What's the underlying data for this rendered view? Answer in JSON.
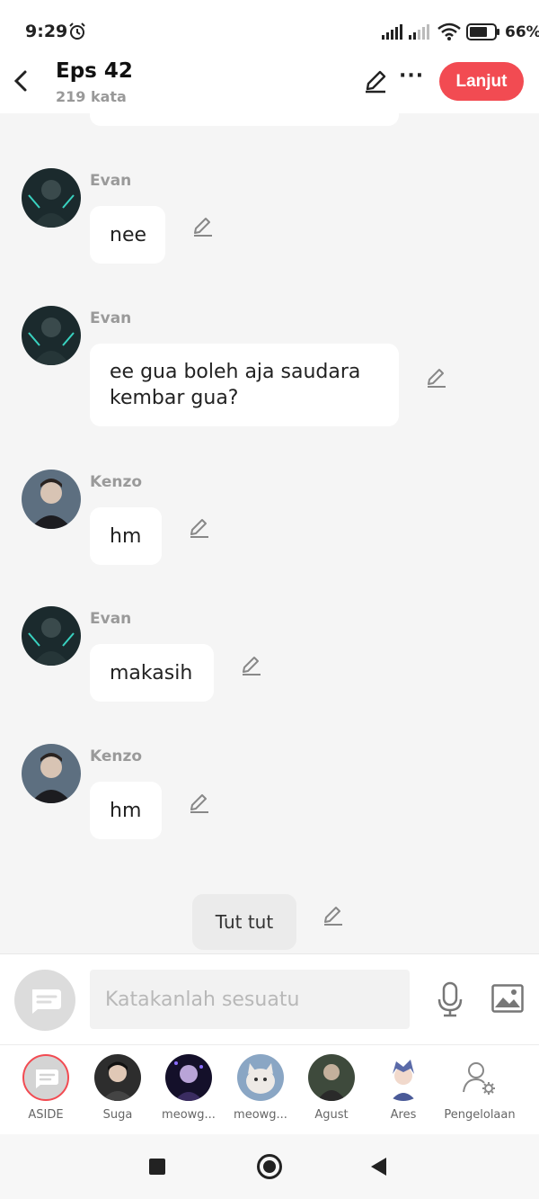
{
  "status": {
    "time": "9:29",
    "battery": "66%"
  },
  "header": {
    "title": "Eps 42",
    "subtitle": "219 kata",
    "action": "Lanjut"
  },
  "messages": [
    {
      "name": "Evan",
      "text": "nee"
    },
    {
      "name": "Evan",
      "text": "ee gua boleh aja saudara kembar gua?"
    },
    {
      "name": "Kenzo",
      "text": "hm"
    },
    {
      "name": "Evan",
      "text": "makasih"
    },
    {
      "name": "Kenzo",
      "text": "hm"
    }
  ],
  "narration": "Tut tut",
  "input": {
    "placeholder": "Katakanlah sesuatu"
  },
  "characters": [
    {
      "label": "ASIDE"
    },
    {
      "label": "Suga"
    },
    {
      "label": "meowg..."
    },
    {
      "label": "meowg..."
    },
    {
      "label": "Agust"
    },
    {
      "label": "Ares"
    },
    {
      "label": "Pengelolaan"
    }
  ],
  "colors": {
    "accent": "#f24b52",
    "bubble": "#ffffff",
    "background": "#f5f5f5"
  }
}
